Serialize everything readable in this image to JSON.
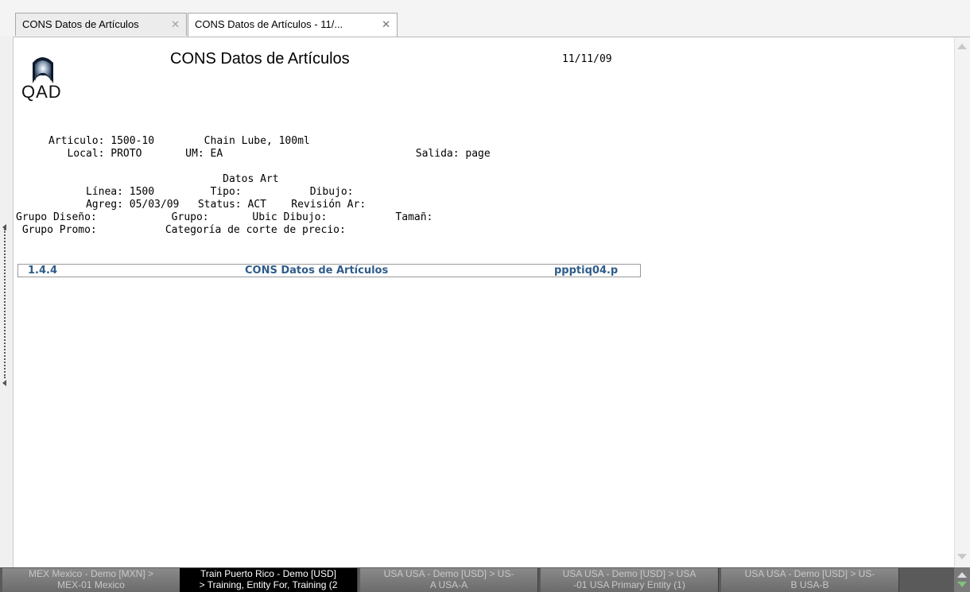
{
  "tabs": [
    {
      "label": "CONS Datos de Artículos",
      "close": "✕"
    },
    {
      "label": "CONS Datos de Artículos - 11/...",
      "close": "✕"
    }
  ],
  "report": {
    "logo_text": "QAD",
    "title": "CONS Datos de Artículos",
    "date": "11/11/09",
    "line_articulo": "Articulo: 1500-10        Chain Lube, 100ml",
    "line_local": "   Local: PROTO       UM: EA                               Salida: page",
    "line_datos_art": "                            Datos Art",
    "line_linea": "      Línea: 1500         Tipo:           Dibujo:",
    "line_agreg": "      Agreg: 05/03/09   Status: ACT    Revisión Ar:",
    "line_grupo_diseno": "Grupo Diseño:            Grupo:       Ubic Dibujo:           Tamañ:",
    "line_grupo_promo": " Grupo Promo:           Categoría de corte de precio:",
    "footer": {
      "code": "1.4.4",
      "title": "CONS Datos de Artículos",
      "program": "ppptiq04.p"
    }
  },
  "taskbar": [
    {
      "line1": "MEX Mexico - Demo [MXN] >",
      "line2": "MEX-01 Mexico",
      "active": false
    },
    {
      "line1": "Train Puerto Rico - Demo [USD]",
      "line2": "> Training, Entity For, Training (2",
      "active": true
    },
    {
      "line1": "USA USA - Demo [USD] > US-",
      "line2": "A USA-A",
      "active": false
    },
    {
      "line1": "USA USA - Demo [USD] > USA",
      "line2": "-01 USA Primary Entity (1)",
      "active": false
    },
    {
      "line1": "USA USA - Demo [USD] > US-",
      "line2": "B USA-B",
      "active": false
    }
  ]
}
